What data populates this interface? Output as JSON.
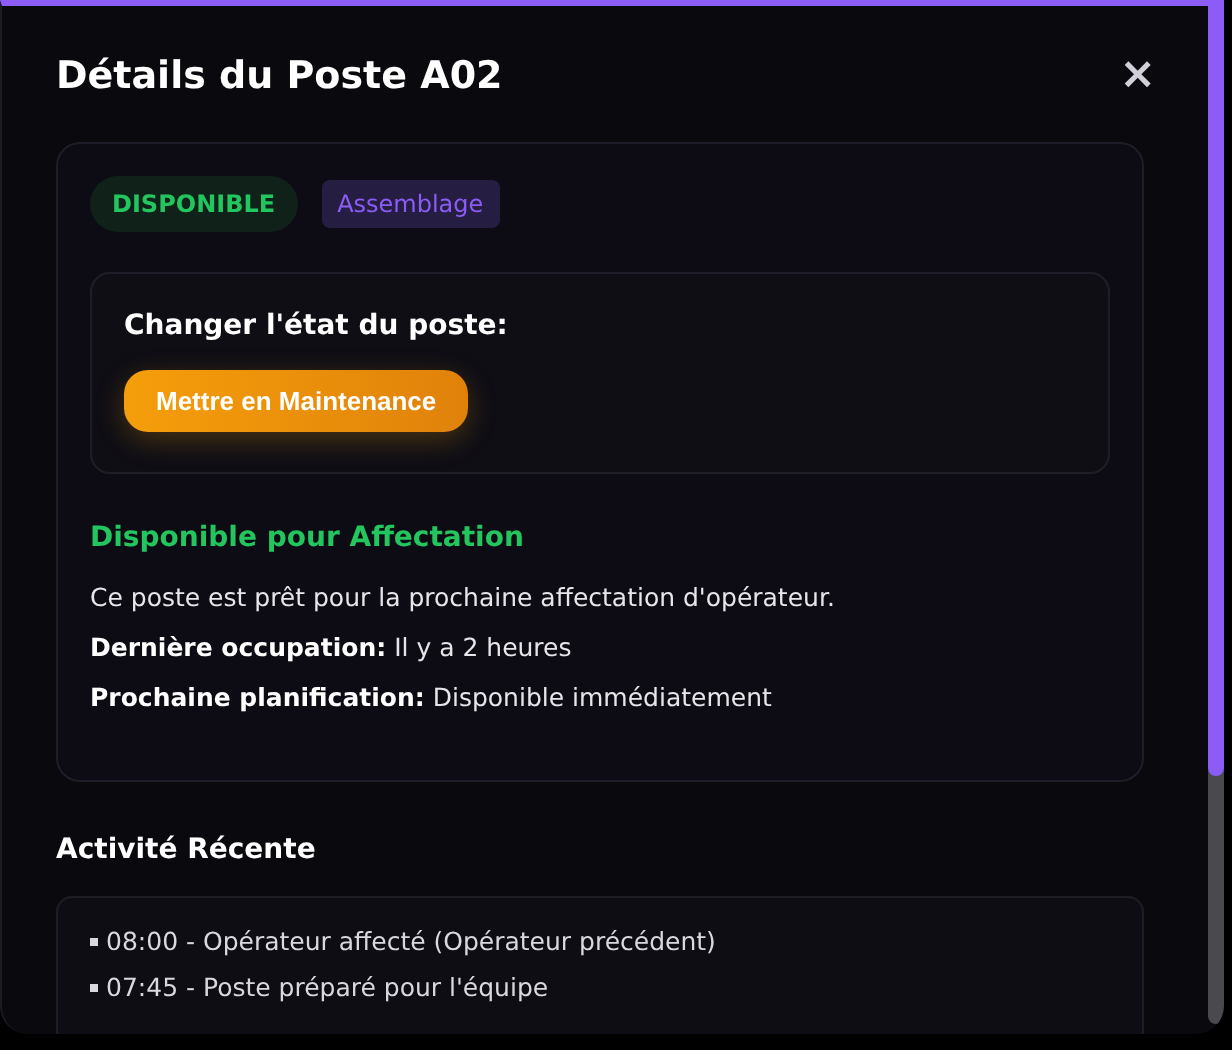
{
  "modal": {
    "title": "Détails du Poste A02",
    "close": "×"
  },
  "badges": [
    {
      "label": "DISPONIBLE",
      "kind": "status"
    },
    {
      "label": "Assemblage",
      "kind": "category"
    }
  ],
  "state_change": {
    "label": "Changer l'état du poste:",
    "button": "Mettre en Maintenance"
  },
  "availability": {
    "heading": "Disponible pour Affectation",
    "lines": [
      "Ce poste est prêt pour la prochaine affectation d'opérateur.",
      "**Dernière occupation:** Il y a 2 heures",
      "**Prochaine planification:** Disponible immédiatement"
    ]
  },
  "activity": {
    "heading": "Activité Récente",
    "items": [
      "08:00 - Opérateur affecté (Opérateur précédent)",
      "07:45 - Poste préparé pour l'équipe"
    ]
  }
}
